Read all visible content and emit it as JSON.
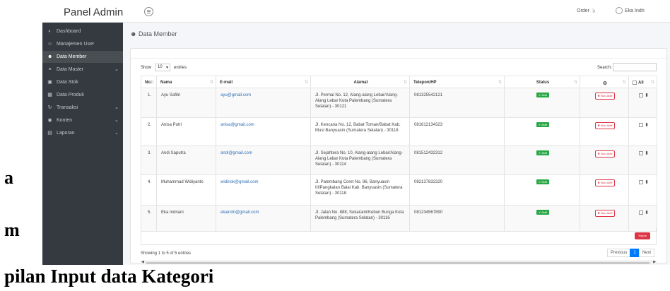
{
  "header": {
    "brand": "Panel Admin",
    "order_label": "Order",
    "user_name": "Eka Indri"
  },
  "sidebar": {
    "items": [
      {
        "label": "Dashboard",
        "icon": "dashboard-icon",
        "active": false,
        "has_children": false
      },
      {
        "label": "Manajemen User",
        "icon": "user-icon",
        "active": false,
        "has_children": false
      },
      {
        "label": "Data Member",
        "icon": "users-icon",
        "active": true,
        "has_children": false
      },
      {
        "label": "Data Master",
        "icon": "list-icon",
        "active": false,
        "has_children": true
      },
      {
        "label": "Data Stok",
        "icon": "box-icon",
        "active": false,
        "has_children": false
      },
      {
        "label": "Data Produk",
        "icon": "product-icon",
        "active": false,
        "has_children": false
      },
      {
        "label": "Transaksi",
        "icon": "refresh-icon",
        "active": false,
        "has_children": true
      },
      {
        "label": "Konten",
        "icon": "content-icon",
        "active": false,
        "has_children": true
      },
      {
        "label": "Laporan",
        "icon": "report-icon",
        "active": false,
        "has_children": true
      }
    ]
  },
  "page": {
    "title": "Data Member"
  },
  "controls": {
    "show_label": "Show",
    "length_value": "10",
    "entries_label": "entries",
    "search_label": "Search:"
  },
  "table": {
    "columns": [
      "No.",
      "Nama",
      "E-mail",
      "Alamat",
      "Telepon/HP",
      "Status",
      "",
      "All"
    ],
    "rows": [
      {
        "no": "1.",
        "nama": "Ayu Safitri",
        "email": "ayu@gmail.com",
        "alamat": "Jl. Permai No. 12, Alang-alang Lebar/Alang-Alang Lebar Kota Palembang (Sumatera Selatan) - 30121",
        "telepon": "081325542121",
        "status": "Aktif",
        "action": "Non-Aktif"
      },
      {
        "no": "2.",
        "nama": "Anisa Putri",
        "email": "anisa@gmail.com",
        "alamat": "Jl. Kencana No. 12, Babat Toman/Babat Kab. Musi Banyuasin (Sumatera Selatan) - 30118",
        "telepon": "081612134323",
        "status": "Aktif",
        "action": "Non-Aktif"
      },
      {
        "no": "3.",
        "nama": "Andi Saputra",
        "email": "andi@gmail.com",
        "alamat": "Jl. Sejahtera No. 10, Alang-alang Lebar/Alang-Alang Lebar Kota Palembang (Sumatera Selatan) - 30114",
        "telepon": "081512432312",
        "status": "Aktif",
        "action": "Non-Aktif"
      },
      {
        "no": "4.",
        "nama": "Muhammad Widiyanto",
        "email": "widinok@gmail.com",
        "alamat": "Jl. Palembang Coret No. 86, Banyuasin III/Pangkalan Balai Kab. Banyuasin (Sumatera Selatan) - 30118",
        "telepon": "082137832320",
        "status": "Aktif",
        "action": "Non-Aktif"
      },
      {
        "no": "5.",
        "nama": "Eka Indriani",
        "email": "ekaindri@gmail.com",
        "alamat": "Jl. Jalan No. 888, Sukarami/Kebun Bunga Kota Palembang (Sumatera Selatan) - 30116",
        "telepon": "081234567890",
        "status": "Aktif",
        "action": "Non-Aktif"
      }
    ],
    "delete_button": "Hapus"
  },
  "footer": {
    "info": "Showing 1 to 5 of 5 entries",
    "pagination": {
      "previous": "Previous",
      "current": "1",
      "next": "Next"
    }
  },
  "document": {
    "fragment_a": "a",
    "fragment_m": "m",
    "caption": "pilan Input data Kategori"
  },
  "colors": {
    "sidebar_bg": "#343a40",
    "active_item_bg": "#494e53",
    "status_green": "#28a745",
    "danger_red": "#dc3545",
    "link_blue": "#2f6fb5",
    "page_active": "#007bff"
  }
}
